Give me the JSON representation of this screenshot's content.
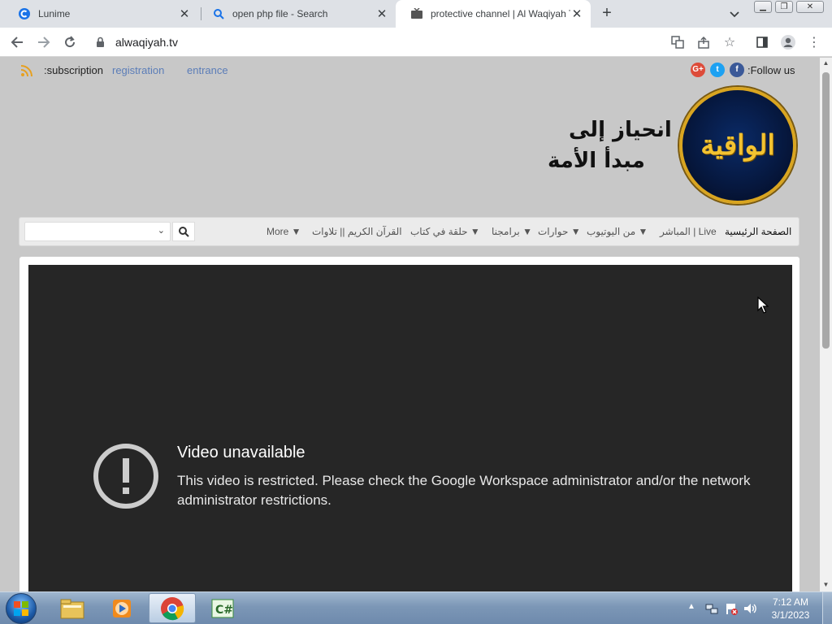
{
  "browser": {
    "tabs": [
      {
        "title": "Lunime",
        "icon": "lunime-icon",
        "active": false
      },
      {
        "title": "open php file - Search",
        "icon": "search-icon",
        "active": false
      },
      {
        "title": "protective channel | Al Waqiyah T",
        "icon": "tv-icon",
        "active": true
      }
    ],
    "url": "alwaqiyah.tv"
  },
  "site": {
    "topbar": {
      "subscription_label": ":subscription",
      "registration_label": "registration",
      "entrance_label": "entrance",
      "follow_label": ":Follow us",
      "social": [
        "G+",
        "t",
        "f"
      ]
    },
    "logo_text": "الواقية",
    "slogan_line1": "انحياز إلى",
    "slogan_line2": "مبدأ الأمة",
    "nav": {
      "items": [
        {
          "label": "الصفحة الرئيسية"
        },
        {
          "label": "المباشر | Live"
        },
        {
          "label": "من اليوتيوب ▼"
        },
        {
          "label": "حوارات ▼"
        },
        {
          "label": "برامجنا ▼"
        },
        {
          "label": "حلقة في كتاب ▼"
        },
        {
          "label": "القرآن الكريم || تلاوات"
        },
        {
          "label": "More ▼"
        }
      ]
    },
    "video": {
      "title": "Video unavailable",
      "message": "This video is restricted. Please check the Google Workspace administrator and/or the network administrator restrictions."
    }
  },
  "taskbar": {
    "apps": [
      "explorer-icon",
      "media-player-icon",
      "chrome-icon",
      "csharp-icon"
    ],
    "time": "7:12 AM",
    "date": "3/1/2023"
  },
  "colors": {
    "accent_blue": "#5b7db8",
    "page_bg": "#c8c8c8",
    "video_bg": "#262626",
    "logo_gold": "#d9a520"
  }
}
